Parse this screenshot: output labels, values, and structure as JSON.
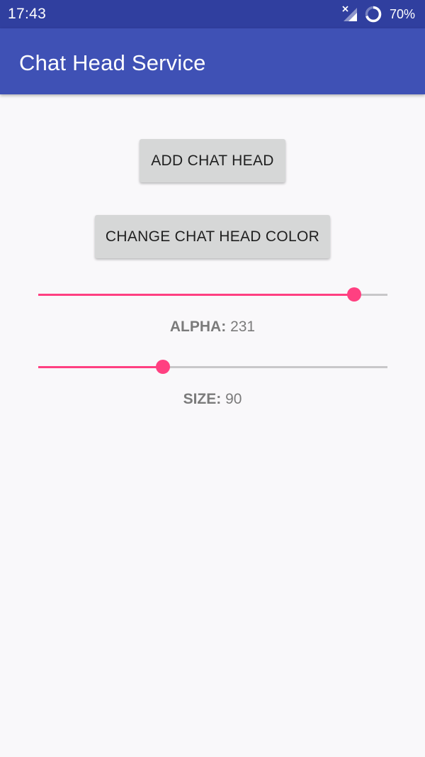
{
  "status_bar": {
    "time": "17:43",
    "battery": "70%",
    "icons": [
      "signal-no-service-icon",
      "battery-ring-icon"
    ]
  },
  "app_bar": {
    "title": "Chat Head Service",
    "color": "#3f51b5",
    "status_color": "#303f9f"
  },
  "buttons": {
    "add_chat_head": "ADD CHAT HEAD",
    "change_color": "CHANGE CHAT HEAD COLOR"
  },
  "alpha": {
    "label": "ALPHA:",
    "value": "231",
    "fraction": 0.905
  },
  "size": {
    "label": "SIZE:",
    "value": "90",
    "fraction": 0.358
  },
  "colors": {
    "accent": "#ff4081",
    "background": "#f9f8fa",
    "button": "#d6d7d7"
  }
}
